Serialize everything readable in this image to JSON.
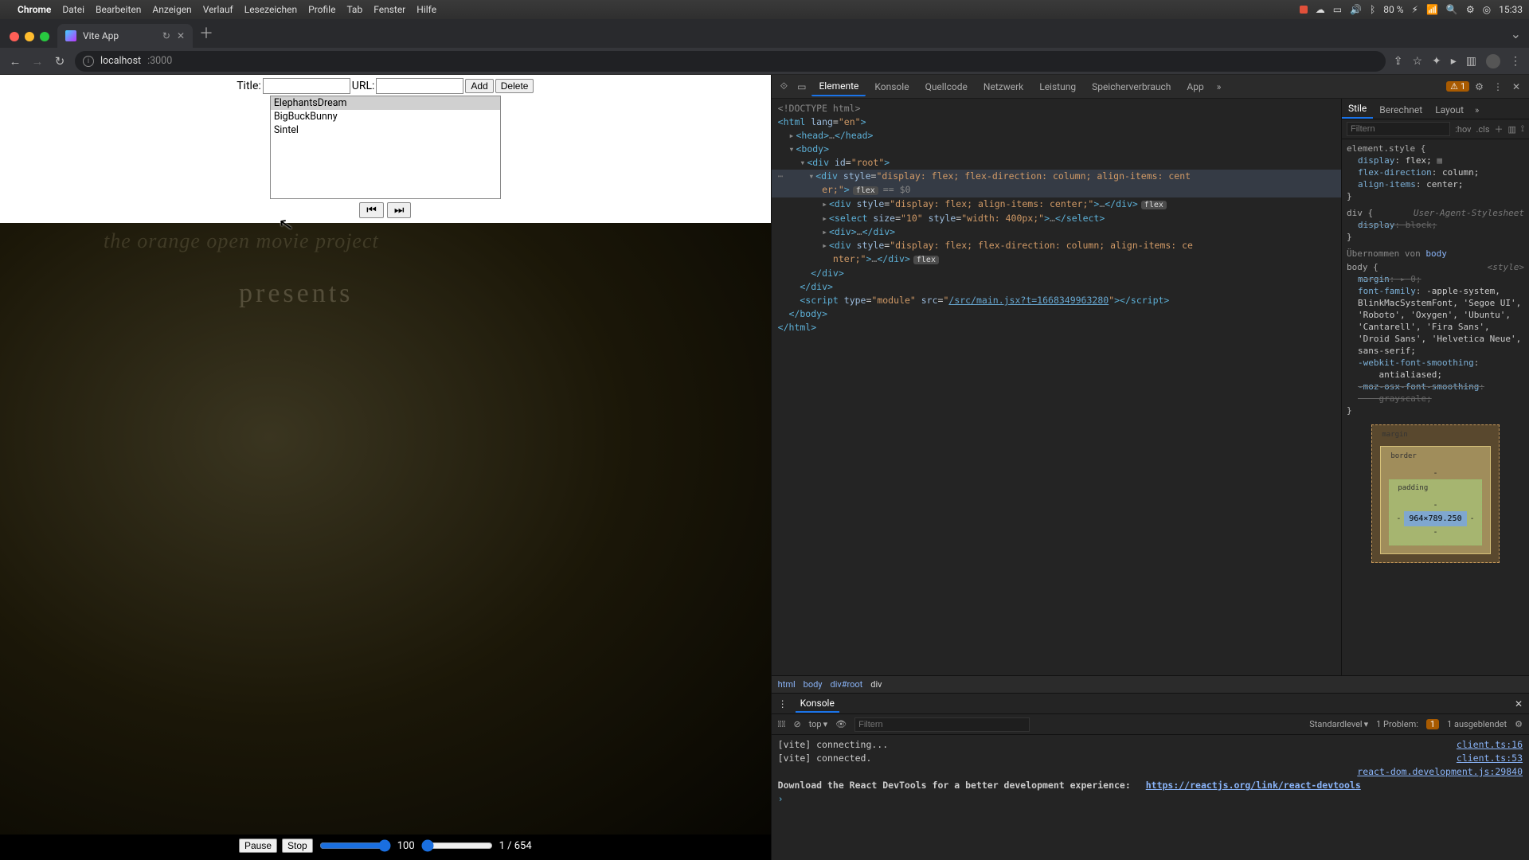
{
  "menubar": {
    "apple": "",
    "app": "Chrome",
    "items": [
      "Datei",
      "Bearbeiten",
      "Anzeigen",
      "Verlauf",
      "Lesezeichen",
      "Profile",
      "Tab",
      "Fenster",
      "Hilfe"
    ],
    "tray": {
      "battery": "80 %",
      "batt_icon": "⚡︎",
      "wifi": "⌁",
      "clock": "15:33"
    }
  },
  "traffic": {
    "close": "#ff5f57",
    "min": "#febc2e",
    "max": "#28c840"
  },
  "tab": {
    "title": "Vite App",
    "reload_mini": "↻",
    "close": "✕"
  },
  "newtab": "＋",
  "toolbar": {
    "back": "←",
    "fwd": "→",
    "reload": "↻",
    "host": "localhost",
    "path": ":3000",
    "share": "⇪",
    "star": "☆",
    "ext": "✦",
    "play": "▸",
    "panel": "▥",
    "menu": "⋮"
  },
  "app": {
    "title_label": "Title:",
    "url_label": "URL:",
    "title_value": "",
    "url_value": "",
    "add": "Add",
    "del": "Delete",
    "options": [
      "ElephantsDream",
      "BigBuckBunny",
      "Sintel"
    ],
    "selected_index": 0,
    "prev": "⏮",
    "next": "⏭",
    "ghost1": "the orange open movie project",
    "ghost2": "presents",
    "pause": "Pause",
    "stop": "Stop",
    "volume_value": "100",
    "time_text": "1 / 654"
  },
  "devtools": {
    "inspect": "⟐",
    "device": "▭",
    "tabs": [
      "Elemente",
      "Konsole",
      "Quellcode",
      "Netzwerk",
      "Leistung",
      "Speicherverbrauch",
      "App"
    ],
    "active_tab": "Elemente",
    "more": "»",
    "warn_count": "1",
    "settings": "⚙",
    "menu": "⋮",
    "close": "✕",
    "dom": {
      "l1": "<!DOCTYPE html>",
      "l2_open": "<html ",
      "l2_attr": "lang",
      "l2_val": "\"en\"",
      "l2_close": ">",
      "l3": "<head>…</head>",
      "l4": "<body>",
      "l5": "<div id=\"root\">",
      "l6": "<div style=\"display: flex; flex-direction: column; align-items: center;\">",
      "l6_flex": "flex",
      "l6_sel": "== $0",
      "l7": "<div style=\"display: flex; align-items: center;\">…</div>",
      "l7_flex": "flex",
      "l8": "<select size=\"10\" style=\"width: 400px;\">…</select>",
      "l9": "<div>…</div>",
      "l10": "<div style=\"display: flex; flex-direction: column; align-items: center;\">…</div>",
      "l10_flex": "flex",
      "l11": "</div>",
      "l12": "</div>",
      "l13a": "<script type=\"module\" src=\"",
      "l13b": "/src/main.jsx?t=1668349963280",
      "l13c": "\"></script>",
      "l14": "</body>",
      "l15": "</html>"
    },
    "crumbs": [
      "html",
      "body",
      "div#root",
      "div"
    ],
    "styles": {
      "tabs": [
        "Stile",
        "Berechnet",
        "Layout"
      ],
      "active": "Stile",
      "chev": "»",
      "filter_ph": "Filtern",
      "hov": ":hov",
      "cls": ".cls",
      "plus": "＋",
      "panel": "▥",
      "pin": "⟟",
      "sel1": "element.style {",
      "p1": "display",
      "v1": "flex;",
      "p2": "flex-direction",
      "v2": "column;",
      "p3": "align-items",
      "v3": "center;",
      "close1": "}",
      "src2": "User-Agent-Stylesheet",
      "sel2": "div {",
      "p4": "display",
      "v4": "block;",
      "close2": "}",
      "inherit_lbl": "Übernommen von ",
      "inherit_from": "body",
      "src3": "<style>",
      "sel3": "body {",
      "p5": "margin",
      "v5": "0;",
      "p6": "font-family",
      "v6": "-apple-system, BlinkMacSystemFont, 'Segoe UI', 'Roboto', 'Oxygen', 'Ubuntu', 'Cantarell', 'Fira Sans', 'Droid Sans', 'Helvetica Neue', sans-serif;",
      "p7": "-webkit-font-smoothing",
      "v7": "antialiased;",
      "p8": "-moz-osx-font-smoothing",
      "v8": "grayscale;",
      "close3": "}",
      "bm_margin": "margin",
      "bm_border": "border",
      "bm_padding": "padding",
      "bm_dash": "-",
      "bm_content": "964×789.250"
    },
    "drawer": {
      "kebab": "⋮",
      "tab": "Konsole",
      "close": "✕",
      "play": "▸⃞",
      "clear": "⊘",
      "ctx": "top",
      "ctx_caret": "▾",
      "eye": "👁",
      "filter_ph": "Filtern",
      "level": "Standardlevel",
      "level_caret": "▾",
      "problem_lbl": "1 Problem:",
      "problem_pill": "1",
      "hidden": "1 ausgeblendet",
      "gear": "⚙",
      "rows": [
        {
          "msg": "[vite] connecting...",
          "src": "client.ts:16"
        },
        {
          "msg": "[vite] connected.",
          "src": "client.ts:53"
        },
        {
          "msg": "",
          "src": "react-dom.development.js:29840"
        },
        {
          "msg": "Download the React DevTools for a better development experience: ",
          "link": "https://reactjs.org/link/react-devtools",
          "src": ""
        }
      ],
      "prompt": "›"
    }
  }
}
